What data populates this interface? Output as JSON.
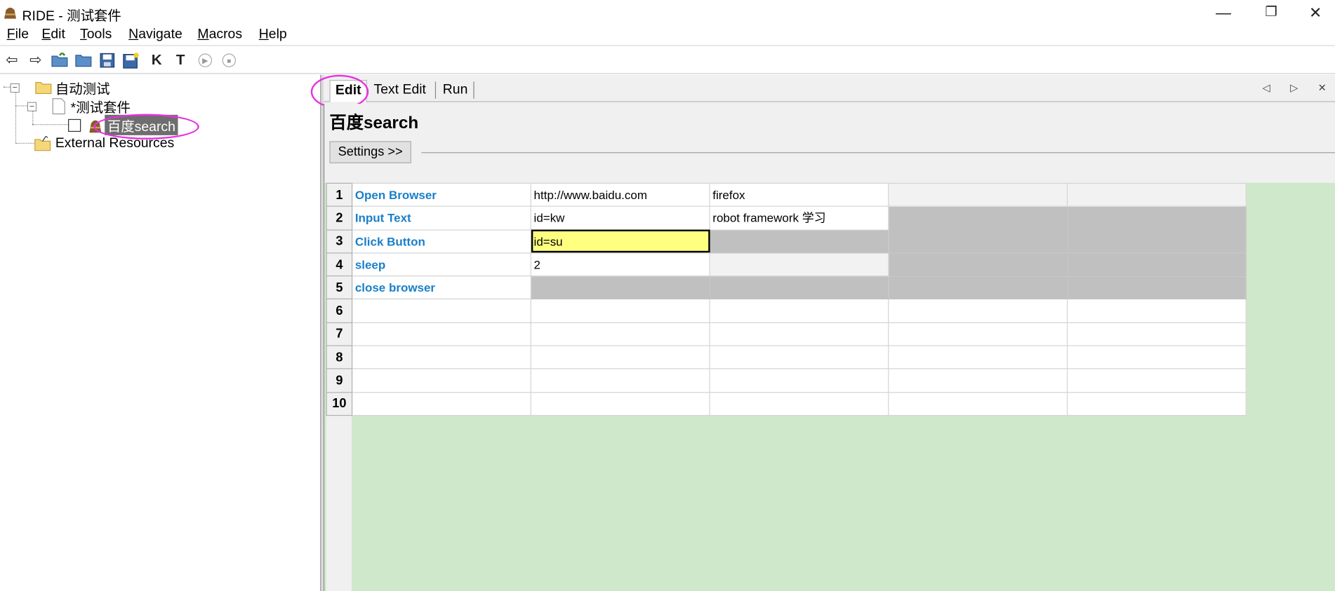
{
  "window": {
    "title": "RIDE - 测试套件",
    "minimize": "—",
    "maximize": "❐",
    "close": "✕"
  },
  "menu": [
    {
      "key": "F",
      "rest": "ile"
    },
    {
      "key": "E",
      "rest": "dit"
    },
    {
      "key": "T",
      "rest": "ools"
    },
    {
      "key": "N",
      "rest": "avigate"
    },
    {
      "key": "M",
      "rest": "acros"
    },
    {
      "key": "H",
      "rest": "elp"
    }
  ],
  "toolbar": {
    "icons": [
      "back-arrow-icon",
      "forward-arrow-icon",
      "open-suite-icon",
      "open-directory-icon",
      "save-icon",
      "save-all-icon",
      "search-keywords-icon",
      "search-tests-icon",
      "run-icon",
      "stop-icon"
    ],
    "glyphs": [
      "⇦",
      "⇨",
      "",
      "",
      "",
      "",
      "K",
      "T",
      "▶",
      "■"
    ]
  },
  "tree": {
    "project": "自动测试",
    "suite": "*测试套件",
    "test_case": "百度search",
    "external": "External Resources"
  },
  "tabs": [
    "Edit",
    "Text Edit",
    "Run"
  ],
  "tab_nav": "◁ ▷ ✕",
  "editor": {
    "title": "百度search",
    "settings_button": "Settings >>"
  },
  "grid": {
    "rows": [
      {
        "n": "1",
        "cells": [
          "Open Browser",
          "http://www.baidu.com",
          "firefox",
          "",
          ""
        ],
        "state": [
          "kw",
          "c",
          "c",
          "opt",
          "opt"
        ]
      },
      {
        "n": "2",
        "cells": [
          "Input Text",
          "id=kw",
          "robot framework 学习",
          "",
          ""
        ],
        "state": [
          "kw",
          "c",
          "c",
          "na",
          "na"
        ]
      },
      {
        "n": "3",
        "cells": [
          "Click Button",
          "id=su",
          "",
          "",
          ""
        ],
        "state": [
          "kw",
          "sel",
          "na",
          "na",
          "na"
        ]
      },
      {
        "n": "4",
        "cells": [
          "sleep",
          "2",
          "",
          "",
          ""
        ],
        "state": [
          "kw",
          "c",
          "opt",
          "na",
          "na"
        ]
      },
      {
        "n": "5",
        "cells": [
          "close browser",
          "",
          "",
          "",
          ""
        ],
        "state": [
          "kw",
          "na",
          "na",
          "na",
          "na"
        ]
      },
      {
        "n": "6",
        "cells": [
          "",
          "",
          "",
          "",
          ""
        ],
        "state": [
          "c",
          "c",
          "c",
          "c",
          "c"
        ]
      },
      {
        "n": "7",
        "cells": [
          "",
          "",
          "",
          "",
          ""
        ],
        "state": [
          "c",
          "c",
          "c",
          "c",
          "c"
        ]
      },
      {
        "n": "8",
        "cells": [
          "",
          "",
          "",
          "",
          ""
        ],
        "state": [
          "c",
          "c",
          "c",
          "c",
          "c"
        ]
      },
      {
        "n": "9",
        "cells": [
          "",
          "",
          "",
          "",
          ""
        ],
        "state": [
          "c",
          "c",
          "c",
          "c",
          "c"
        ]
      },
      {
        "n": "10",
        "cells": [
          "",
          "",
          "",
          "",
          ""
        ],
        "state": [
          "c",
          "c",
          "c",
          "c",
          "c"
        ]
      }
    ]
  },
  "colors": {
    "keyword": "#1a7fc8",
    "selected_cell": "#ffff80",
    "unused_cell": "#c0c0c0",
    "grid_background": "#cfe8cb",
    "annotation": "#e830e0"
  }
}
